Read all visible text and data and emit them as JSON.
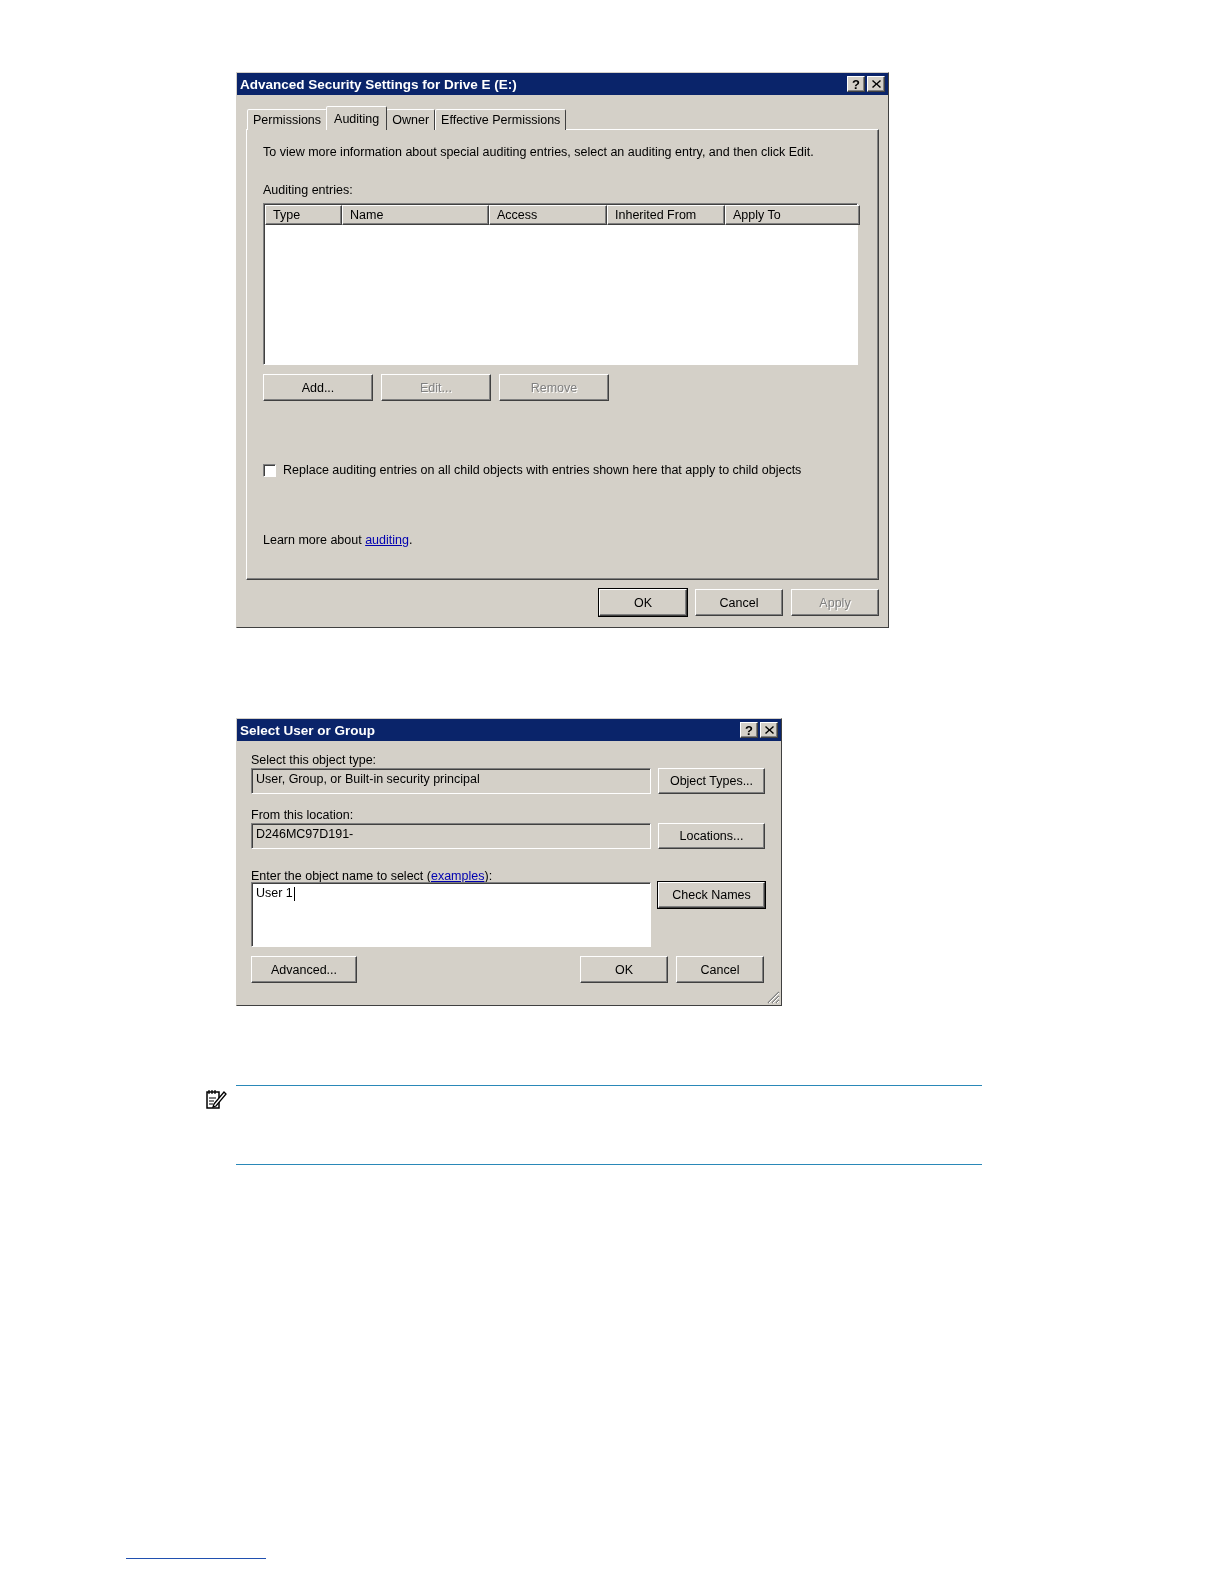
{
  "security_dialog": {
    "title": "Advanced Security Settings for Drive E (E:)",
    "help_button": "?",
    "tabs": [
      {
        "label": "Permissions",
        "selected": false
      },
      {
        "label": "Auditing",
        "selected": true
      },
      {
        "label": "Owner",
        "selected": false
      },
      {
        "label": "Effective Permissions",
        "selected": false
      }
    ],
    "instructions": "To view more information about special auditing entries, select an auditing entry, and then click Edit.",
    "entries_label": "Auditing entries:",
    "columns": [
      "Type",
      "Name",
      "Access",
      "Inherited From",
      "Apply To"
    ],
    "list_buttons": [
      {
        "label": "Add...",
        "disabled": false
      },
      {
        "label": "Edit...",
        "disabled": true
      },
      {
        "label": "Remove",
        "disabled": true
      }
    ],
    "checkbox": {
      "label": "Replace auditing entries on all child objects with entries shown here that apply to child objects",
      "checked": false
    },
    "learn_more": {
      "text": "Learn more about ",
      "link": "auditing",
      "suffix": "."
    },
    "buttons": [
      {
        "label": "OK",
        "disabled": false,
        "default": true
      },
      {
        "label": "Cancel",
        "disabled": false,
        "default": false
      },
      {
        "label": "Apply",
        "disabled": true,
        "default": false
      }
    ]
  },
  "select_dialog": {
    "title": "Select User or Group",
    "help_button": "?",
    "fields": [
      {
        "label": "Select this object type:",
        "value": "User, Group, or Built-in security principal",
        "button": "Object Types..."
      },
      {
        "label": "From this location:",
        "value": "D246MC97D191-",
        "button": "Locations..."
      }
    ],
    "name_field": {
      "label": "Enter the object name to select (",
      "link": "examples",
      "suffix": "):",
      "value": "User 1",
      "button": "Check Names"
    },
    "advanced_button": "Advanced...",
    "buttons": [
      {
        "label": "OK",
        "default": false
      },
      {
        "label": "Cancel",
        "default": false
      }
    ]
  }
}
